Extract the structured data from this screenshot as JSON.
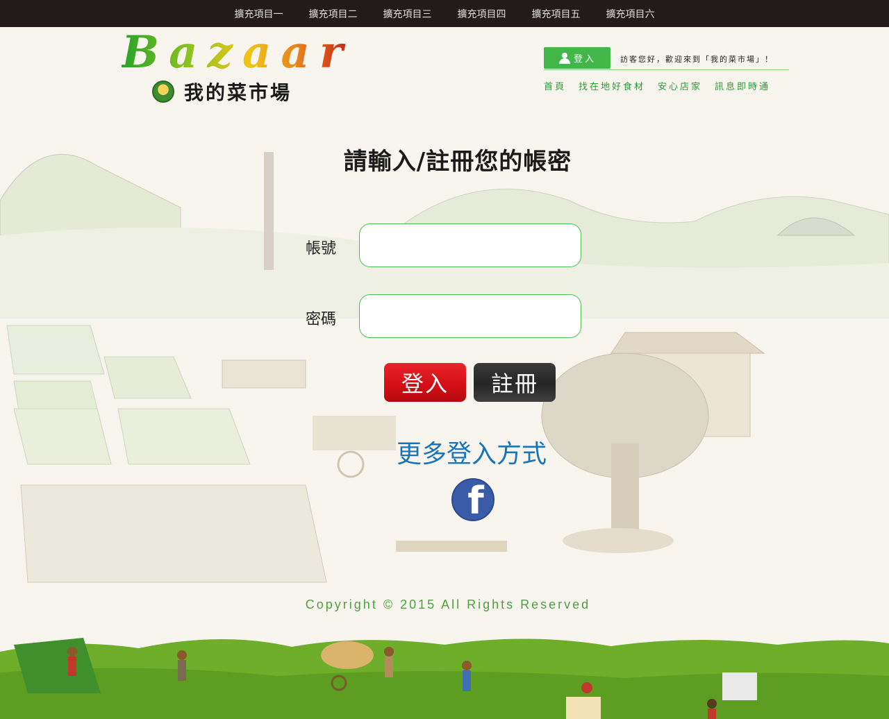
{
  "topbar": {
    "items": [
      "擴充項目一",
      "擴充項目二",
      "擴充項目三",
      "擴充項目四",
      "擴充項目五",
      "擴充項目六"
    ]
  },
  "logo": {
    "word": "Bazaar",
    "subtitle": "我的菜市場"
  },
  "header": {
    "login_label": "登入",
    "welcome": "訪客您好，歡迎來到「我的菜市場」！",
    "nav": [
      "首頁",
      "找在地好食材",
      "安心店家",
      "訊息即時通"
    ]
  },
  "form": {
    "title": "請輸入/註冊您的帳密",
    "account_label": "帳號",
    "account_value": "",
    "password_label": "密碼",
    "password_value": "",
    "login_button": "登入",
    "register_button": "註冊",
    "more_login": "更多登入方式",
    "facebook_glyph": "f"
  },
  "footer": {
    "copyright": "Copyright © 2015 All Rights Reserved"
  },
  "colors": {
    "topbar_bg": "#231b1b",
    "accent_green": "#43b64a",
    "login_red": "#d50f16",
    "register_dark": "#262626",
    "link_blue": "#1b74b8",
    "facebook_blue": "#3a5ba8"
  }
}
